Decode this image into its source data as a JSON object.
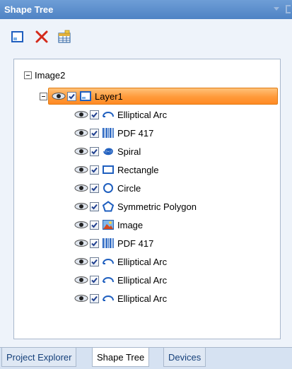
{
  "panel": {
    "title": "Shape Tree"
  },
  "toolbar": {
    "buttons": [
      {
        "name": "new-shape",
        "icon": "new-document-icon"
      },
      {
        "name": "delete",
        "icon": "delete-x-icon"
      },
      {
        "name": "properties",
        "icon": "properties-grid-icon"
      }
    ]
  },
  "tree": {
    "root": {
      "label": "Image2"
    },
    "layer": {
      "label": "Layer1"
    },
    "items": [
      {
        "label": "Elliptical Arc",
        "icon": "elliptical-arc-icon"
      },
      {
        "label": "PDF 417",
        "icon": "barcode-icon"
      },
      {
        "label": "Spiral",
        "icon": "spiral-icon"
      },
      {
        "label": "Rectangle",
        "icon": "rectangle-icon"
      },
      {
        "label": "Circle",
        "icon": "circle-icon"
      },
      {
        "label": "Symmetric Polygon",
        "icon": "polygon-icon"
      },
      {
        "label": "Image",
        "icon": "image-icon"
      },
      {
        "label": "PDF 417",
        "icon": "barcode-icon"
      },
      {
        "label": "Elliptical Arc",
        "icon": "elliptical-arc-icon"
      },
      {
        "label": "Elliptical Arc",
        "icon": "elliptical-arc-icon"
      },
      {
        "label": "Elliptical Arc",
        "icon": "elliptical-arc-icon"
      }
    ]
  },
  "tabs": [
    {
      "label": "Project Explorer",
      "active": false
    },
    {
      "label": "Shape Tree",
      "active": true
    },
    {
      "label": "Devices",
      "active": false
    }
  ],
  "colors": {
    "title_bar": "#5b8ccb",
    "selection": "#ff9a3a",
    "icon_blue": "#1f5fbf",
    "delete_red": "#d42a1a"
  }
}
